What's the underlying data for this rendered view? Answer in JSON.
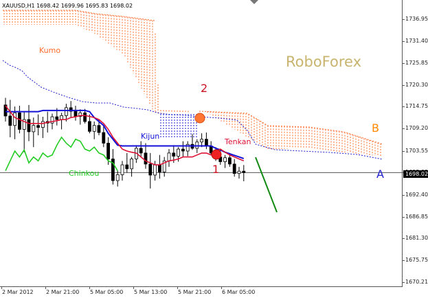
{
  "header": {
    "symbol_info": "XAUUSD,H1  1698.42 1699.96 1695.83 1698.02"
  },
  "watermark": {
    "text": "RoboForex",
    "color": "#c8b46e"
  },
  "labels": {
    "kumo": "Kumo",
    "kijun": "Kijun",
    "tenkan": "Tenkan",
    "chinkou": "Chinkou",
    "point_1": "1",
    "point_2": "2",
    "point_a": "A",
    "point_b": "B"
  },
  "price_badge": "1698.02",
  "colors": {
    "kumo": "#ff6a2a",
    "kijun": "#1010d8",
    "tenkan": "#dd1133",
    "chinkou": "#22cc22",
    "senkou_b_dashed": "#1a1ad0",
    "level_a": "#555555",
    "arrow": "#128a12",
    "marker_red": "#ee2222",
    "marker_orange": "#ff7733",
    "label_a": "#2222cc",
    "label_b": "#ff8800",
    "label_numbers": "#cc1122"
  },
  "chart_data": {
    "type": "candlestick",
    "symbol": "XAUUSD",
    "timeframe": "H1",
    "ylim": [
      1670.21,
      1739.4
    ],
    "y_ticks": [
      "1736.95",
      "1731.40",
      "1725.85",
      "1720.30",
      "1714.75",
      "1709.20",
      "1703.55",
      "1698.02",
      "1692.40",
      "1686.85",
      "1681.30",
      "1675.75",
      "1670.21"
    ],
    "x_ticks": [
      "2 Mar 2012",
      "2 Mar 21:00",
      "5 Mar 05:00",
      "5 Mar 13:00",
      "5 Mar 21:00",
      "6 Mar 05:00"
    ],
    "current_price": 1698.02,
    "level_a": 1698.02,
    "candles": [
      [
        1715.2,
        1717.0,
        1711.0,
        1712.4
      ],
      [
        1712.4,
        1716.5,
        1707.0,
        1710.0
      ],
      [
        1710.0,
        1714.8,
        1706.5,
        1713.2
      ],
      [
        1713.2,
        1715.0,
        1708.0,
        1709.0
      ],
      [
        1709.0,
        1713.5,
        1703.2,
        1711.5
      ],
      [
        1711.5,
        1715.2,
        1706.0,
        1708.4
      ],
      [
        1708.4,
        1712.0,
        1704.5,
        1710.0
      ],
      [
        1710.0,
        1712.8,
        1707.5,
        1709.5
      ],
      [
        1709.5,
        1712.2,
        1706.8,
        1711.0
      ],
      [
        1711.0,
        1713.5,
        1708.2,
        1710.6
      ],
      [
        1710.6,
        1713.0,
        1709.0,
        1712.2
      ],
      [
        1712.2,
        1714.4,
        1710.0,
        1711.5
      ],
      [
        1711.5,
        1713.2,
        1709.0,
        1712.5
      ],
      [
        1712.5,
        1715.5,
        1711.0,
        1714.5
      ],
      [
        1714.5,
        1716.2,
        1712.0,
        1713.6
      ],
      [
        1713.6,
        1715.0,
        1711.2,
        1712.3
      ],
      [
        1712.3,
        1714.1,
        1710.2,
        1713.2
      ],
      [
        1713.2,
        1714.2,
        1710.5,
        1711.0
      ],
      [
        1711.0,
        1712.8,
        1708.0,
        1708.5
      ],
      [
        1708.5,
        1711.0,
        1706.5,
        1710.0
      ],
      [
        1710.0,
        1711.5,
        1707.5,
        1708.2
      ],
      [
        1708.2,
        1710.0,
        1704.5,
        1705.5
      ],
      [
        1705.5,
        1707.0,
        1700.0,
        1701.5
      ],
      [
        1701.5,
        1704.0,
        1695.0,
        1696.0
      ],
      [
        1696.0,
        1698.5,
        1694.5,
        1697.5
      ],
      [
        1697.5,
        1701.0,
        1696.0,
        1700.0
      ],
      [
        1700.0,
        1703.0,
        1698.0,
        1699.0
      ],
      [
        1699.0,
        1702.0,
        1697.0,
        1701.5
      ],
      [
        1701.5,
        1705.0,
        1700.5,
        1704.2
      ],
      [
        1704.2,
        1706.0,
        1702.0,
        1703.0
      ],
      [
        1703.0,
        1705.5,
        1699.0,
        1700.2
      ],
      [
        1700.2,
        1703.0,
        1694.0,
        1697.4
      ],
      [
        1697.4,
        1701.0,
        1696.0,
        1700.0
      ],
      [
        1700.0,
        1702.5,
        1696.5,
        1698.2
      ],
      [
        1698.2,
        1702.0,
        1697.0,
        1701.0
      ],
      [
        1701.0,
        1704.0,
        1699.5,
        1703.0
      ],
      [
        1703.0,
        1705.0,
        1700.5,
        1702.2
      ],
      [
        1702.2,
        1704.5,
        1700.8,
        1704.0
      ],
      [
        1704.0,
        1706.0,
        1702.0,
        1703.5
      ],
      [
        1703.5,
        1706.0,
        1702.2,
        1705.2
      ],
      [
        1705.2,
        1707.8,
        1703.8,
        1704.2
      ],
      [
        1704.2,
        1706.5,
        1703.0,
        1705.8
      ],
      [
        1705.8,
        1708.0,
        1704.5,
        1706.5
      ],
      [
        1706.5,
        1708.2,
        1704.0,
        1704.8
      ],
      [
        1704.8,
        1706.0,
        1702.5,
        1703.0
      ],
      [
        1703.0,
        1704.5,
        1701.0,
        1702.0
      ],
      [
        1702.0,
        1704.0,
        1700.0,
        1700.8
      ],
      [
        1700.8,
        1702.5,
        1699.2,
        1701.8
      ],
      [
        1701.8,
        1703.0,
        1699.5,
        1700.2
      ],
      [
        1700.2,
        1701.5,
        1697.0,
        1697.8
      ],
      [
        1697.8,
        1699.5,
        1696.5,
        1698.4
      ],
      [
        1698.4,
        1699.96,
        1695.83,
        1698.02
      ]
    ],
    "tenkan": [
      1715.0,
      1713.5,
      1712.0,
      1711.5,
      1711.0,
      1710.5,
      1710.5,
      1710.5,
      1710.5,
      1710.8,
      1711.0,
      1711.2,
      1711.5,
      1711.5,
      1712.0,
      1712.2,
      1712.5,
      1712.5,
      1712.3,
      1712.0,
      1711.5,
      1710.5,
      1709.0,
      1707.0,
      1705.5,
      1704.0,
      1703.5,
      1703.2,
      1703.0,
      1702.0,
      1701.0,
      1700.5,
      1700.0,
      1700.0,
      1700.5,
      1701.0,
      1701.2,
      1701.5,
      1702.0,
      1702.0,
      1702.0,
      1702.5,
      1703.0,
      1703.0,
      1702.5,
      1703.5,
      1704.0,
      1703.2,
      1702.5,
      1702.0,
      1701.5,
      1701.0
    ],
    "kijun": [
      1713.5,
      1713.5,
      1713.5,
      1713.5,
      1713.5,
      1713.5,
      1713.5,
      1713.5,
      1713.8,
      1713.8,
      1713.8,
      1713.8,
      1713.8,
      1713.8,
      1713.8,
      1713.8,
      1713.8,
      1713.8,
      1713.5,
      1712.0,
      1711.0,
      1710.0,
      1708.0,
      1706.5,
      1705.0,
      1704.8,
      1704.8,
      1704.8,
      1704.8,
      1704.8,
      1704.8,
      1704.8,
      1704.8,
      1704.8,
      1704.8,
      1704.8,
      1704.8,
      1704.8,
      1704.8,
      1704.8,
      1704.8,
      1704.8,
      1704.8,
      1704.8,
      1704.8,
      1704.2,
      1703.8,
      1703.2,
      1702.8,
      1702.4,
      1702.0,
      1701.6
    ],
    "chinkou": [
      1698.5,
      1701.0,
      1703.5,
      1702.0,
      1703.8,
      1700.5,
      1702.0,
      1701.0,
      1703.0,
      1702.0,
      1702.5,
      1705.0,
      1707.0,
      1705.5,
      1704.5,
      1706.5,
      1706.0,
      1704.0,
      1703.5,
      1704.5,
      1703.0,
      1702.5,
      1701.0,
      1700.5,
      1698.5
    ]
  }
}
